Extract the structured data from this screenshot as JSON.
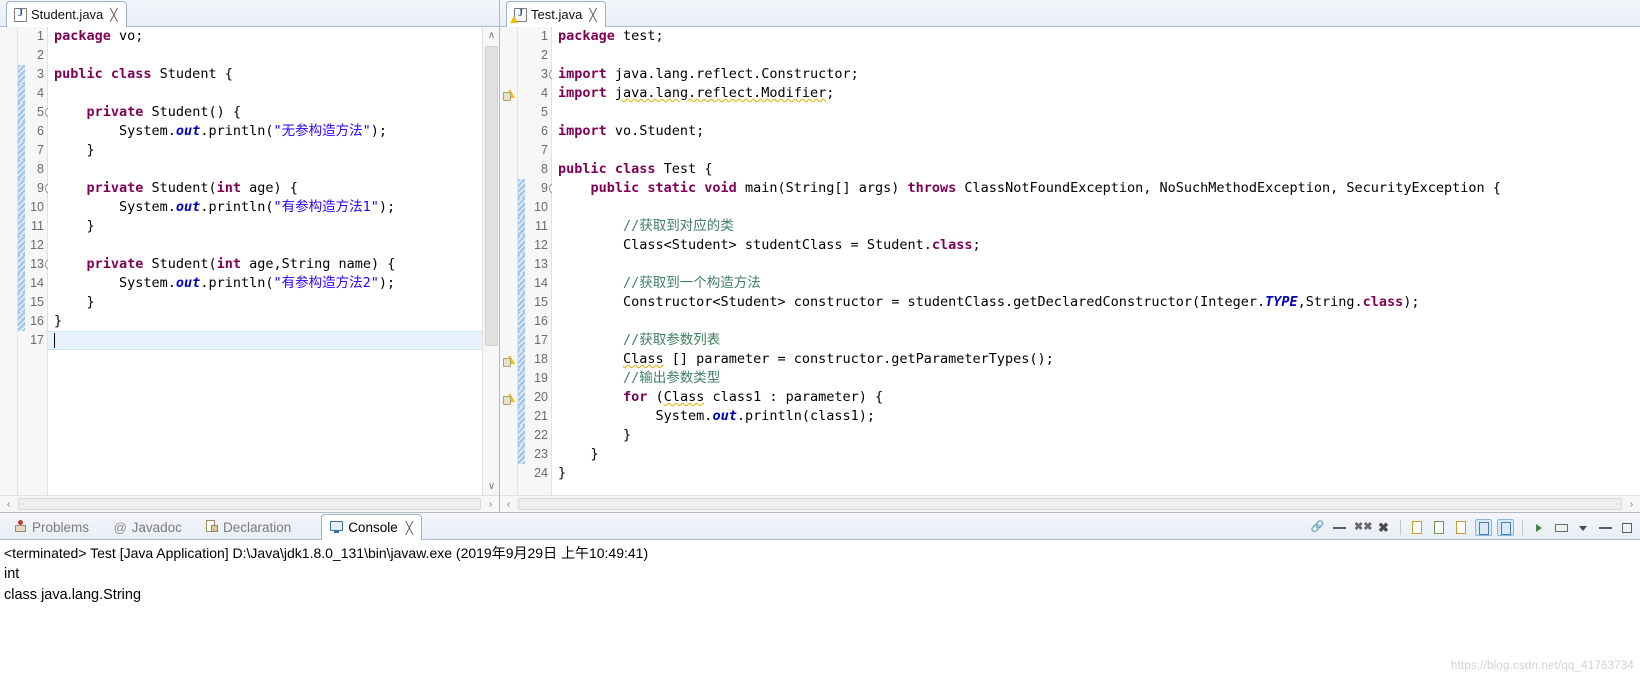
{
  "editors": [
    {
      "tab": {
        "label": "Student.java",
        "close": "╳",
        "icon": "java-file-icon",
        "has_warning": false,
        "active": true
      },
      "first_line": 1,
      "lines": [
        {
          "n": 1,
          "fold": false,
          "change": false,
          "marker": "",
          "tokens": [
            {
              "t": "package",
              "c": "kw"
            },
            {
              "t": " vo;",
              "c": "plain"
            }
          ]
        },
        {
          "n": 2,
          "fold": false,
          "change": false,
          "marker": "",
          "tokens": []
        },
        {
          "n": 3,
          "fold": false,
          "change": true,
          "marker": "",
          "tokens": [
            {
              "t": "public class",
              "c": "kw"
            },
            {
              "t": " Student {",
              "c": "plain"
            }
          ]
        },
        {
          "n": 4,
          "fold": false,
          "change": true,
          "marker": "",
          "tokens": []
        },
        {
          "n": 5,
          "fold": true,
          "change": true,
          "marker": "",
          "tokens": [
            {
              "t": "    ",
              "c": "plain"
            },
            {
              "t": "private",
              "c": "kw"
            },
            {
              "t": " Student() {",
              "c": "plain"
            }
          ]
        },
        {
          "n": 6,
          "fold": false,
          "change": true,
          "marker": "",
          "tokens": [
            {
              "t": "        System.",
              "c": "plain"
            },
            {
              "t": "out",
              "c": "fld"
            },
            {
              "t": ".println(",
              "c": "plain"
            },
            {
              "t": "\"无参构造方法\"",
              "c": "str"
            },
            {
              "t": ");",
              "c": "plain"
            }
          ]
        },
        {
          "n": 7,
          "fold": false,
          "change": true,
          "marker": "",
          "tokens": [
            {
              "t": "    }",
              "c": "plain"
            }
          ]
        },
        {
          "n": 8,
          "fold": false,
          "change": true,
          "marker": "",
          "tokens": []
        },
        {
          "n": 9,
          "fold": true,
          "change": true,
          "marker": "",
          "tokens": [
            {
              "t": "    ",
              "c": "plain"
            },
            {
              "t": "private",
              "c": "kw"
            },
            {
              "t": " Student(",
              "c": "plain"
            },
            {
              "t": "int",
              "c": "kw"
            },
            {
              "t": " age) {",
              "c": "plain"
            }
          ]
        },
        {
          "n": 10,
          "fold": false,
          "change": true,
          "marker": "",
          "tokens": [
            {
              "t": "        System.",
              "c": "plain"
            },
            {
              "t": "out",
              "c": "fld"
            },
            {
              "t": ".println(",
              "c": "plain"
            },
            {
              "t": "\"有参构造方法1\"",
              "c": "str"
            },
            {
              "t": ");",
              "c": "plain"
            }
          ]
        },
        {
          "n": 11,
          "fold": false,
          "change": true,
          "marker": "",
          "tokens": [
            {
              "t": "    }",
              "c": "plain"
            }
          ]
        },
        {
          "n": 12,
          "fold": false,
          "change": true,
          "marker": "",
          "tokens": []
        },
        {
          "n": 13,
          "fold": true,
          "change": true,
          "marker": "",
          "tokens": [
            {
              "t": "    ",
              "c": "plain"
            },
            {
              "t": "private",
              "c": "kw"
            },
            {
              "t": " Student(",
              "c": "plain"
            },
            {
              "t": "int",
              "c": "kw"
            },
            {
              "t": " age,String name) {",
              "c": "plain"
            }
          ]
        },
        {
          "n": 14,
          "fold": false,
          "change": true,
          "marker": "",
          "tokens": [
            {
              "t": "        System.",
              "c": "plain"
            },
            {
              "t": "out",
              "c": "fld"
            },
            {
              "t": ".println(",
              "c": "plain"
            },
            {
              "t": "\"有参构造方法2\"",
              "c": "str"
            },
            {
              "t": ");",
              "c": "plain"
            }
          ]
        },
        {
          "n": 15,
          "fold": false,
          "change": true,
          "marker": "",
          "tokens": [
            {
              "t": "    }",
              "c": "plain"
            }
          ]
        },
        {
          "n": 16,
          "fold": false,
          "change": true,
          "marker": "",
          "tokens": [
            {
              "t": "}",
              "c": "plain"
            }
          ]
        },
        {
          "n": 17,
          "fold": false,
          "change": false,
          "marker": "",
          "caret": true,
          "tokens": []
        }
      ]
    },
    {
      "tab": {
        "label": "Test.java",
        "close": "╳",
        "icon": "java-file-icon",
        "has_warning": true,
        "active": true
      },
      "first_line": 1,
      "lines": [
        {
          "n": 1,
          "fold": false,
          "change": false,
          "marker": "",
          "tokens": [
            {
              "t": "package",
              "c": "kw"
            },
            {
              "t": " test;",
              "c": "plain"
            }
          ]
        },
        {
          "n": 2,
          "fold": false,
          "change": false,
          "marker": "",
          "tokens": []
        },
        {
          "n": 3,
          "fold": true,
          "change": false,
          "marker": "",
          "tokens": [
            {
              "t": "import",
              "c": "kw"
            },
            {
              "t": " java.lang.reflect.Constructor;",
              "c": "plain"
            }
          ]
        },
        {
          "n": 4,
          "fold": false,
          "change": false,
          "marker": "warning",
          "tokens": [
            {
              "t": "import",
              "c": "kw"
            },
            {
              "t": " ",
              "c": "plain"
            },
            {
              "t": "java.lang.reflect.Modifier",
              "c": "plain",
              "warn": true
            },
            {
              "t": ";",
              "c": "plain"
            }
          ]
        },
        {
          "n": 5,
          "fold": false,
          "change": false,
          "marker": "",
          "tokens": []
        },
        {
          "n": 6,
          "fold": false,
          "change": false,
          "marker": "",
          "tokens": [
            {
              "t": "import",
              "c": "kw"
            },
            {
              "t": " vo.Student;",
              "c": "plain"
            }
          ]
        },
        {
          "n": 7,
          "fold": false,
          "change": false,
          "marker": "",
          "tokens": []
        },
        {
          "n": 8,
          "fold": false,
          "change": false,
          "marker": "",
          "tokens": [
            {
              "t": "public class",
              "c": "kw"
            },
            {
              "t": " Test {",
              "c": "plain"
            }
          ]
        },
        {
          "n": 9,
          "fold": true,
          "change": true,
          "marker": "",
          "tokens": [
            {
              "t": "    ",
              "c": "plain"
            },
            {
              "t": "public static void",
              "c": "kw"
            },
            {
              "t": " main(String[] args) ",
              "c": "plain"
            },
            {
              "t": "throws",
              "c": "kw"
            },
            {
              "t": " ClassNotFoundException, NoSuchMethodException, SecurityException {",
              "c": "plain"
            }
          ]
        },
        {
          "n": 10,
          "fold": false,
          "change": true,
          "marker": "",
          "tokens": []
        },
        {
          "n": 11,
          "fold": false,
          "change": true,
          "marker": "",
          "tokens": [
            {
              "t": "        ",
              "c": "plain"
            },
            {
              "t": "//获取到对应的类",
              "c": "cmt"
            }
          ]
        },
        {
          "n": 12,
          "fold": false,
          "change": true,
          "marker": "",
          "tokens": [
            {
              "t": "        Class<Student> studentClass = Student.",
              "c": "plain"
            },
            {
              "t": "class",
              "c": "kw"
            },
            {
              "t": ";",
              "c": "plain"
            }
          ]
        },
        {
          "n": 13,
          "fold": false,
          "change": true,
          "marker": "",
          "tokens": []
        },
        {
          "n": 14,
          "fold": false,
          "change": true,
          "marker": "",
          "tokens": [
            {
              "t": "        ",
              "c": "plain"
            },
            {
              "t": "//获取到一个构造方法",
              "c": "cmt"
            }
          ]
        },
        {
          "n": 15,
          "fold": false,
          "change": true,
          "marker": "",
          "tokens": [
            {
              "t": "        Constructor<Student> constructor = studentClass.getDeclaredConstructor(Integer.",
              "c": "plain"
            },
            {
              "t": "TYPE",
              "c": "fld"
            },
            {
              "t": ",String.",
              "c": "plain"
            },
            {
              "t": "class",
              "c": "kw"
            },
            {
              "t": ");",
              "c": "plain"
            }
          ]
        },
        {
          "n": 16,
          "fold": false,
          "change": true,
          "marker": "",
          "tokens": []
        },
        {
          "n": 17,
          "fold": false,
          "change": true,
          "marker": "",
          "tokens": [
            {
              "t": "        ",
              "c": "plain"
            },
            {
              "t": "//获取参数列表",
              "c": "cmt"
            }
          ]
        },
        {
          "n": 18,
          "fold": false,
          "change": true,
          "marker": "warning",
          "tokens": [
            {
              "t": "        ",
              "c": "plain"
            },
            {
              "t": "Class",
              "c": "plain",
              "warn": true
            },
            {
              "t": " [] parameter = constructor.getParameterTypes();",
              "c": "plain"
            }
          ]
        },
        {
          "n": 19,
          "fold": false,
          "change": true,
          "marker": "",
          "tokens": [
            {
              "t": "        ",
              "c": "plain"
            },
            {
              "t": "//输出参数类型",
              "c": "cmt"
            }
          ]
        },
        {
          "n": 20,
          "fold": false,
          "change": true,
          "marker": "warning",
          "tokens": [
            {
              "t": "        ",
              "c": "plain"
            },
            {
              "t": "for",
              "c": "kw"
            },
            {
              "t": " (",
              "c": "plain"
            },
            {
              "t": "Class",
              "c": "plain",
              "warn": true
            },
            {
              "t": " class1 : parameter) {",
              "c": "plain"
            }
          ]
        },
        {
          "n": 21,
          "fold": false,
          "change": true,
          "marker": "",
          "tokens": [
            {
              "t": "            System.",
              "c": "plain"
            },
            {
              "t": "out",
              "c": "fld"
            },
            {
              "t": ".println(class1);",
              "c": "plain"
            }
          ]
        },
        {
          "n": 22,
          "fold": false,
          "change": true,
          "marker": "",
          "tokens": [
            {
              "t": "        }",
              "c": "plain"
            }
          ]
        },
        {
          "n": 23,
          "fold": false,
          "change": true,
          "marker": "",
          "tokens": [
            {
              "t": "    }",
              "c": "plain"
            }
          ]
        },
        {
          "n": 24,
          "fold": false,
          "change": false,
          "marker": "",
          "tokens": [
            {
              "t": "}",
              "c": "plain"
            }
          ]
        }
      ]
    }
  ],
  "scroll": {
    "up_arrow": "∧",
    "down_arrow": "∨",
    "left_arrow": "‹",
    "right_arrow": "›"
  },
  "bottom_view": {
    "tabs": [
      {
        "label": "Problems",
        "icon": "problems-icon",
        "active": false,
        "close": ""
      },
      {
        "label": "Javadoc",
        "icon": "javadoc-icon",
        "active": false,
        "close": ""
      },
      {
        "label": "Declaration",
        "icon": "declaration-icon",
        "active": false,
        "close": ""
      },
      {
        "label": "Console",
        "icon": "console-icon",
        "active": true,
        "close": "╳"
      }
    ],
    "console": {
      "header": "<terminated> Test [Java Application] D:\\Java\\jdk1.8.0_131\\bin\\javaw.exe (2019年9月29日 上午10:49:41)",
      "output": [
        "int",
        "class java.lang.String"
      ]
    },
    "toolbar": [
      {
        "icon": "link-icon",
        "active": false
      },
      {
        "icon": "terminate-icon",
        "active": false
      },
      {
        "icon": "remove-launch-icon",
        "active": false
      },
      {
        "icon": "remove-all-icon",
        "active": false
      },
      {
        "icon": "separator",
        "active": false
      },
      {
        "icon": "clear-console-icon",
        "active": false
      },
      {
        "icon": "scroll-lock-icon",
        "active": false
      },
      {
        "icon": "word-wrap-icon",
        "active": false
      },
      {
        "icon": "show-console-icon",
        "active": true
      },
      {
        "icon": "pin-console-icon",
        "active": true
      },
      {
        "icon": "separator",
        "active": false
      },
      {
        "icon": "open-console-icon",
        "active": false
      },
      {
        "icon": "display-console-icon",
        "active": false
      },
      {
        "icon": "menu-dropdown-icon",
        "active": false
      },
      {
        "icon": "minimize-view-icon",
        "active": false
      },
      {
        "icon": "maximize-view-icon",
        "active": false
      }
    ]
  },
  "watermark": "https://blog.csdn.net/qq_41763734"
}
